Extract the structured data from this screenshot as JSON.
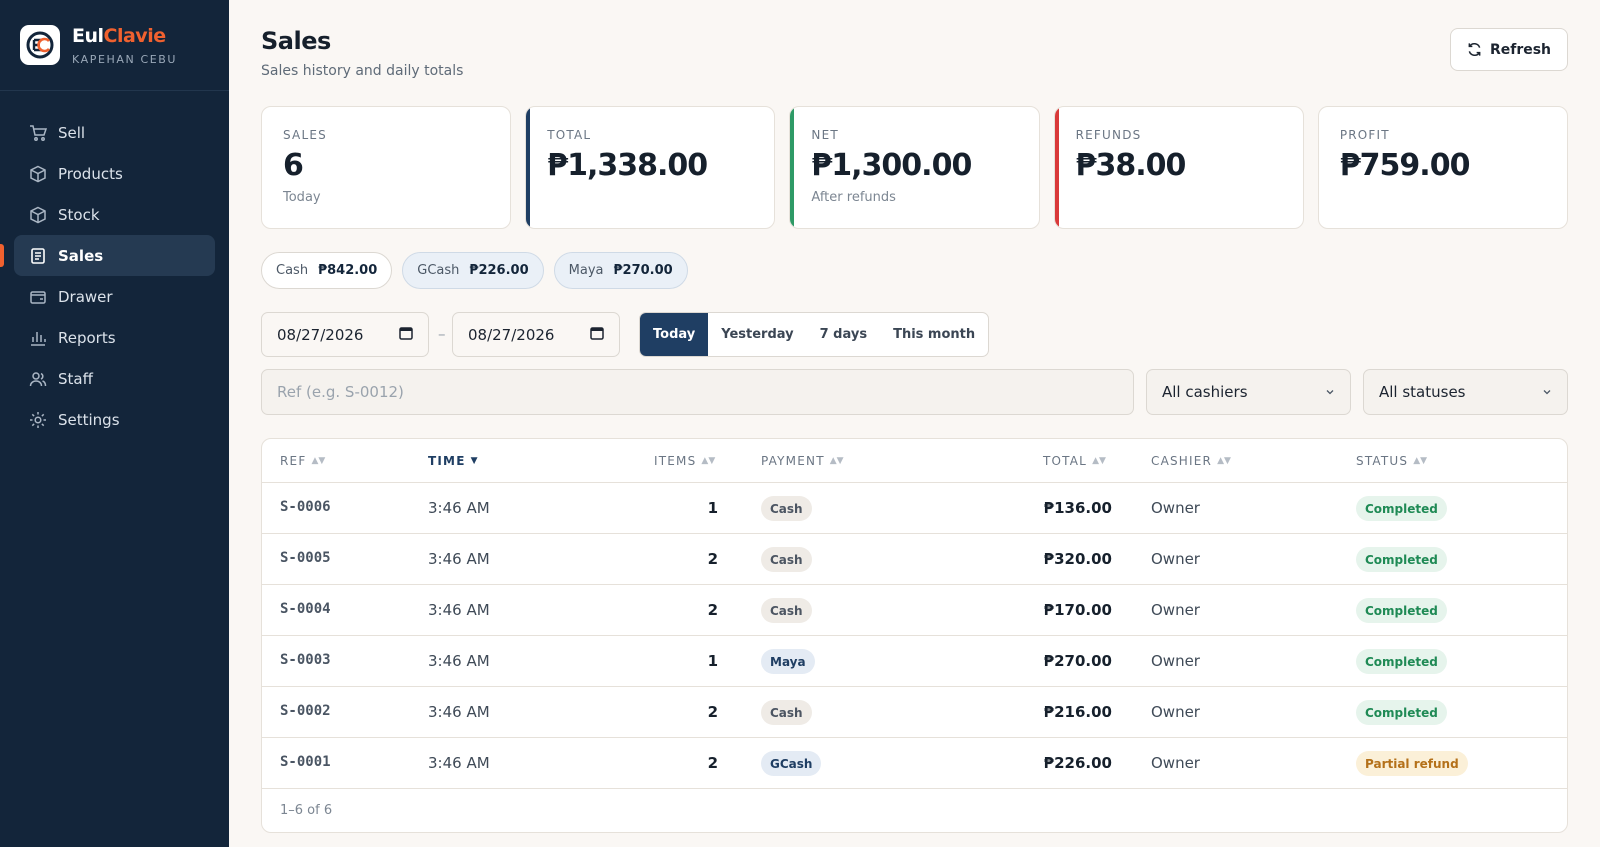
{
  "brand": {
    "name_part1": "Eul",
    "name_part2": "Clavie",
    "subtitle": "KAPEHAN CEBU"
  },
  "nav": [
    {
      "label": "Sell",
      "icon": "cart-icon"
    },
    {
      "label": "Products",
      "icon": "box-icon"
    },
    {
      "label": "Stock",
      "icon": "stock-icon"
    },
    {
      "label": "Sales",
      "icon": "receipt-icon",
      "active": true
    },
    {
      "label": "Drawer",
      "icon": "wallet-icon"
    },
    {
      "label": "Reports",
      "icon": "bar-chart-icon"
    },
    {
      "label": "Staff",
      "icon": "users-icon"
    },
    {
      "label": "Settings",
      "icon": "gear-icon"
    }
  ],
  "header": {
    "title": "Sales",
    "subtitle": "Sales history and daily totals",
    "refresh_label": "Refresh"
  },
  "cards": [
    {
      "label": "SALES",
      "value": "6",
      "note": "Today"
    },
    {
      "label": "TOTAL",
      "value": "₱1,338.00",
      "note": "",
      "accent": "#1f3e63"
    },
    {
      "label": "NET",
      "value": "₱1,300.00",
      "note": "After refunds",
      "accent": "#2e9a66"
    },
    {
      "label": "REFUNDS",
      "value": "₱38.00",
      "note": "",
      "accent": "#d93a3a"
    },
    {
      "label": "PROFIT",
      "value": "₱759.00",
      "note": ""
    }
  ],
  "payment_totals": [
    {
      "label": "Cash",
      "value": "₱842.00"
    },
    {
      "label": "GCash",
      "value": "₱226.00"
    },
    {
      "label": "Maya",
      "value": "₱270.00"
    }
  ],
  "filters": {
    "date_from": "08/27/2026",
    "date_to": "08/27/2026",
    "date_separator": "–",
    "ranges": [
      "Today",
      "Yesterday",
      "7 days",
      "This month"
    ],
    "active_range": "Today",
    "ref_placeholder": "Ref (e.g. S-0012)",
    "cashier_select": "All cashiers",
    "status_select": "All statuses"
  },
  "table": {
    "columns": [
      "REF",
      "TIME",
      "ITEMS",
      "PAYMENT",
      "TOTAL",
      "CASHIER",
      "STATUS"
    ],
    "sorted_column": "TIME",
    "rows": [
      {
        "ref": "S-0006",
        "time": "3:46 AM",
        "items": "1",
        "payment": "Cash",
        "total": "₱136.00",
        "cashier": "Owner",
        "status": "Completed"
      },
      {
        "ref": "S-0005",
        "time": "3:46 AM",
        "items": "2",
        "payment": "Cash",
        "total": "₱320.00",
        "cashier": "Owner",
        "status": "Completed"
      },
      {
        "ref": "S-0004",
        "time": "3:46 AM",
        "items": "2",
        "payment": "Cash",
        "total": "₱170.00",
        "cashier": "Owner",
        "status": "Completed"
      },
      {
        "ref": "S-0003",
        "time": "3:46 AM",
        "items": "1",
        "payment": "Maya",
        "total": "₱270.00",
        "cashier": "Owner",
        "status": "Completed"
      },
      {
        "ref": "S-0002",
        "time": "3:46 AM",
        "items": "2",
        "payment": "Cash",
        "total": "₱216.00",
        "cashier": "Owner",
        "status": "Completed"
      },
      {
        "ref": "S-0001",
        "time": "3:46 AM",
        "items": "2",
        "payment": "GCash",
        "total": "₱226.00",
        "cashier": "Owner",
        "status": "Partial refund"
      }
    ],
    "footer": "1–6 of 6"
  },
  "colors": {
    "sidebar": "#13253a",
    "accent_orange": "#f0612f",
    "navy": "#1f3e63",
    "success": "#1f8a55",
    "warning": "#b4711a"
  }
}
